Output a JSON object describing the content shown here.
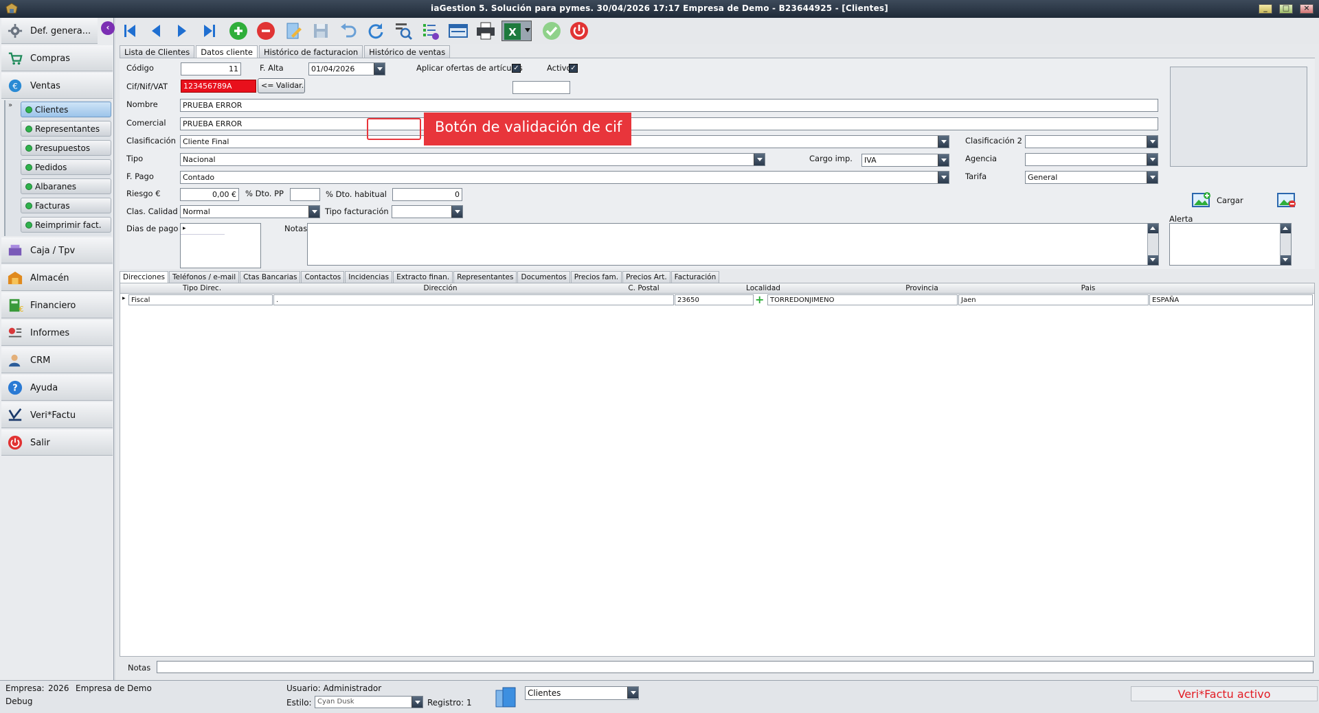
{
  "window": {
    "title": "iaGestion 5. Solución para pymes.  30/04/2026 17:17   Empresa de Demo - B23644925 - [Clientes]"
  },
  "sidebar": {
    "collapse_glyph": "‹",
    "items": [
      {
        "label": "Def. genera...",
        "icon": "gear-icon"
      },
      {
        "label": "Compras",
        "icon": "cart-icon"
      },
      {
        "label": "Ventas",
        "icon": "sales-icon"
      },
      {
        "label": "Caja / Tpv",
        "icon": "cash-register-icon"
      },
      {
        "label": "Almacén",
        "icon": "warehouse-icon"
      },
      {
        "label": "Financiero",
        "icon": "finance-icon"
      },
      {
        "label": "Informes",
        "icon": "reports-icon"
      },
      {
        "label": "CRM",
        "icon": "crm-icon"
      },
      {
        "label": "Ayuda",
        "icon": "help-icon"
      },
      {
        "label": "Veri*Factu",
        "icon": "verifactu-icon"
      },
      {
        "label": "Salir",
        "icon": "power-icon"
      }
    ],
    "submenu_arrow": "»",
    "submenu": [
      {
        "label": "Clientes",
        "active": true
      },
      {
        "label": "Representantes"
      },
      {
        "label": "Presupuestos"
      },
      {
        "label": "Pedidos"
      },
      {
        "label": "Albaranes"
      },
      {
        "label": "Facturas"
      },
      {
        "label": "Reimprimir fact."
      }
    ]
  },
  "toolbar": {
    "buttons": [
      "first-record-icon",
      "previous-record-icon",
      "next-record-icon",
      "last-record-icon",
      "add-icon",
      "delete-icon",
      "edit-icon",
      "save-icon",
      "undo-icon",
      "refresh-icon",
      "search-icon",
      "list-icon",
      "card-icon",
      "print-icon",
      "excel-icon",
      "validate-icon",
      "power-icon"
    ]
  },
  "top_tabs": [
    "Lista de Clientes",
    "Datos cliente",
    "Histórico de facturacion",
    "Histórico de ventas"
  ],
  "form": {
    "codigo_label": "Código",
    "codigo": "11",
    "falta_label": "F. Alta",
    "falta": "01/04/2026",
    "aplicar_label": "Aplicar ofertas de artículos",
    "activo_label": "Activo",
    "check_glyph": "✓",
    "cif_label": "Cif/Nif/VAT",
    "cif": "123456789A",
    "validar_label": "<= Validar.",
    "nombre_label": "Nombre",
    "nombre": "PRUEBA ERROR",
    "comercial_label": "Comercial",
    "comercial": "PRUEBA ERROR",
    "clasificacion_label": "Clasificación",
    "clasificacion": "Cliente Final",
    "clasificacion2_label": "Clasificación 2",
    "clasificacion2": "",
    "tipo_label": "Tipo",
    "tipo": "Nacional",
    "cargo_label": "Cargo imp.",
    "cargo": "IVA",
    "agencia_label": "Agencia",
    "agencia": "",
    "fpago_label": "F. Pago",
    "fpago": "Contado",
    "tarifa_label": "Tarifa",
    "tarifa": "General",
    "riesgo_label": "Riesgo €",
    "riesgo": "0,00 €",
    "dtopp_label": "% Dto. PP",
    "dtopp": "",
    "dtohab_label": "% Dto. habitual",
    "dtohab": "0",
    "calidad_label": "Clas. Calidad",
    "calidad": "Normal",
    "tipofact_label": "Tipo facturación",
    "tipofact": "",
    "diaspago_label": "Dias de pago",
    "notas_label": "Notas",
    "alerta_label": "Alerta",
    "cargar_label": "Cargar"
  },
  "tooltip": "Botón de validación de cif",
  "detail_tabs": [
    "Direcciones",
    "Teléfonos / e-mail",
    "Ctas Bancarias",
    "Contactos",
    "Incidencias",
    "Extracto finan.",
    "Representantes",
    "Documentos",
    "Precios fam.",
    "Precios Art.",
    "Facturación"
  ],
  "grid": {
    "columns": [
      "Tipo Direc.",
      "Dirección",
      "C. Postal",
      "Localidad",
      "Provincia",
      "Pais"
    ],
    "rows": [
      {
        "tipo": "Fiscal",
        "direccion": ".",
        "cp": "23650",
        "localidad": "TORREDONJIMENO",
        "provincia": "Jaen",
        "pais": "ESPAÑA"
      }
    ],
    "row_marker": "▸",
    "plus_glyph": "+"
  },
  "bottom_notes_label": "Notas",
  "status": {
    "empresa_label": "Empresa:",
    "empresa_code": "2026",
    "empresa_name": "Empresa de Demo",
    "debug": "Debug",
    "usuario": "Usuario: Administrador",
    "estilo_label": "Estilo:",
    "estilo": "Cyan Dusk",
    "registro": "Registro:  1",
    "module": "Clientes",
    "verifactu": "Veri*Factu activo"
  }
}
